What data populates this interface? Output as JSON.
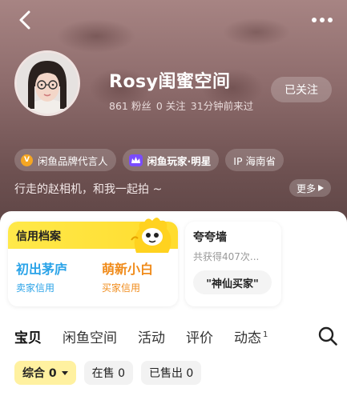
{
  "profile": {
    "username": "Rosy闺蜜空间",
    "followers": "861 粉丝",
    "following": "0 关注",
    "last_seen": "31分钟前来过",
    "follow_label": "已关注",
    "bio": "行走的赵相机，和我一起拍 ~",
    "more_label": "更多"
  },
  "tags": [
    {
      "badge": "V",
      "label": "闲鱼品牌代言人"
    },
    {
      "brand": "闲鱼玩家",
      "label": "·明星"
    },
    {
      "label": "IP 海南省"
    }
  ],
  "credit": {
    "title": "信用档案",
    "seller_value": "初出茅庐",
    "seller_label": "卖家信用",
    "buyer_value": "萌新小白",
    "buyer_label": "买家信用"
  },
  "praise": {
    "title": "夸夸墙",
    "subtitle": "共获得407次...",
    "pill": "\"神仙买家\""
  },
  "tabs": [
    {
      "label": "宝贝"
    },
    {
      "label": "闲鱼空间"
    },
    {
      "label": "活动"
    },
    {
      "label": "评价"
    },
    {
      "label": "动态",
      "badge": "1"
    }
  ],
  "filters": [
    {
      "label": "综合 0"
    },
    {
      "label": "在售 0"
    },
    {
      "label": "已售出 0"
    }
  ],
  "icons": {
    "back": "back-arrow-icon",
    "more": "more-dots-icon",
    "search": "search-icon",
    "mascot": "mascot-icon"
  },
  "colors": {
    "accent_yellow": "#ffe234",
    "seller_blue": "#2aa3e8",
    "buyer_orange": "#f08b1a"
  }
}
